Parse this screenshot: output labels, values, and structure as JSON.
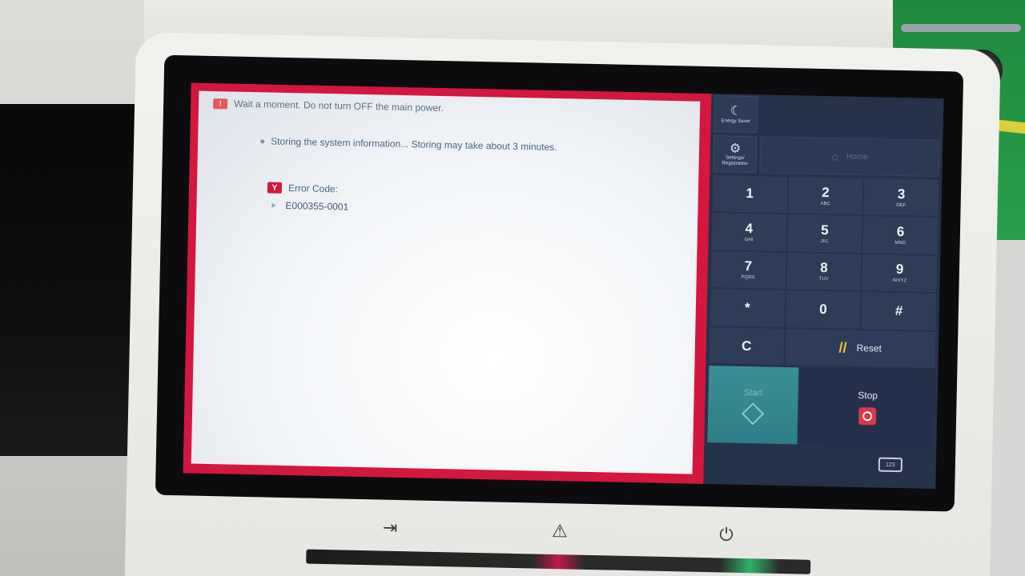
{
  "message": {
    "warning": "Wait a moment. Do not turn OFF the main power.",
    "storing": "Storing the system information... Storing may take about 3 minutes.",
    "error_title": "Error Code:",
    "error_code": "E000355-0001"
  },
  "keypad": {
    "energy_saver": "Energy Saver",
    "settings": "Settings/ Registration",
    "home": "Home",
    "keys": [
      {
        "num": "1",
        "sub": ""
      },
      {
        "num": "2",
        "sub": "ABC"
      },
      {
        "num": "3",
        "sub": "DEF"
      },
      {
        "num": "4",
        "sub": "GHI"
      },
      {
        "num": "5",
        "sub": "JKL"
      },
      {
        "num": "6",
        "sub": "MNO"
      },
      {
        "num": "7",
        "sub": "PQRS"
      },
      {
        "num": "8",
        "sub": "TUV"
      },
      {
        "num": "9",
        "sub": "WXYZ"
      },
      {
        "num": "*",
        "sub": ""
      },
      {
        "num": "0",
        "sub": ""
      },
      {
        "num": "#",
        "sub": ""
      }
    ],
    "clear": "C",
    "reset": "Reset",
    "start": "Start",
    "stop": "Stop"
  },
  "colors": {
    "error_red": "#d3173e",
    "keypad_bg": "#26324a",
    "start_teal": "#3a8f98"
  }
}
